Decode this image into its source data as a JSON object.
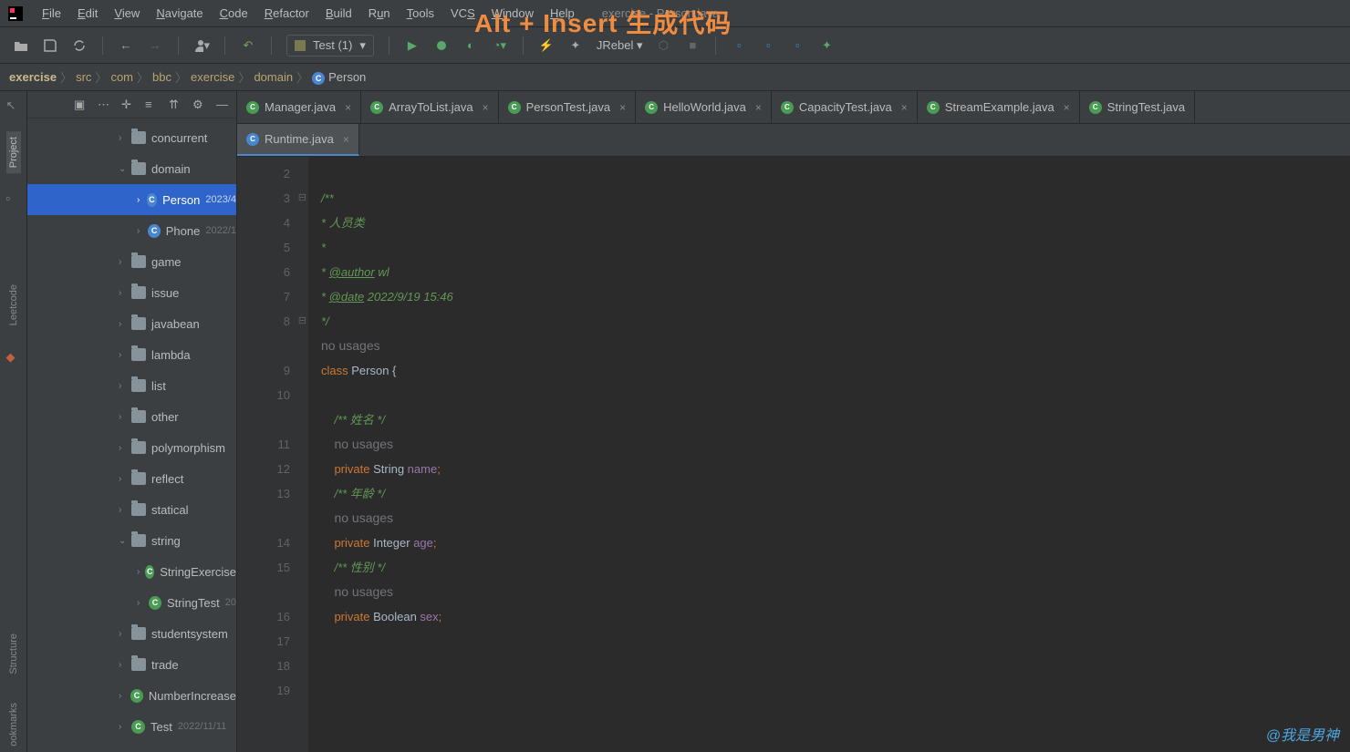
{
  "overlay": "Alt + Insert  生成代码",
  "menu": {
    "file": "File",
    "edit": "Edit",
    "view": "View",
    "navigate": "Navigate",
    "code": "Code",
    "refactor": "Refactor",
    "build": "Build",
    "run": "Run",
    "tools": "Tools",
    "vcs": "VCS",
    "window": "Window",
    "help": "Help",
    "title": "exercise - Person.java"
  },
  "toolbar": {
    "run_config": "Test (1)",
    "jrebel": "JRebel"
  },
  "breadcrumbs": [
    "exercise",
    "src",
    "com",
    "bbc",
    "exercise",
    "domain",
    "Person"
  ],
  "rail": {
    "project": "Project",
    "leetcode": "Leetcode",
    "structure": "Structure",
    "bookmarks": "ookmarks"
  },
  "tree": [
    {
      "ind": "ind3",
      "arrow": "›",
      "type": "folder",
      "label": "concurrent"
    },
    {
      "ind": "ind3",
      "arrow": "⌄",
      "type": "folder",
      "label": "domain"
    },
    {
      "ind": "ind2",
      "arrow": "›",
      "type": "class",
      "label": "Person",
      "date": "2023/4",
      "selected": true
    },
    {
      "ind": "ind2",
      "arrow": "›",
      "type": "class",
      "label": "Phone",
      "date": "2022/1"
    },
    {
      "ind": "ind3",
      "arrow": "›",
      "type": "folder",
      "label": "game"
    },
    {
      "ind": "ind3",
      "arrow": "›",
      "type": "folder",
      "label": "issue"
    },
    {
      "ind": "ind3",
      "arrow": "›",
      "type": "folder",
      "label": "javabean"
    },
    {
      "ind": "ind3",
      "arrow": "›",
      "type": "folder",
      "label": "lambda"
    },
    {
      "ind": "ind3",
      "arrow": "›",
      "type": "folder",
      "label": "list"
    },
    {
      "ind": "ind3",
      "arrow": "›",
      "type": "folder",
      "label": "other"
    },
    {
      "ind": "ind3",
      "arrow": "›",
      "type": "folder",
      "label": "polymorphism"
    },
    {
      "ind": "ind3",
      "arrow": "›",
      "type": "folder",
      "label": "reflect"
    },
    {
      "ind": "ind3",
      "arrow": "›",
      "type": "folder",
      "label": "statical"
    },
    {
      "ind": "ind3",
      "arrow": "⌄",
      "type": "folder",
      "label": "string"
    },
    {
      "ind": "ind2",
      "arrow": "›",
      "type": "class-g",
      "label": "StringExercise"
    },
    {
      "ind": "ind2",
      "arrow": "›",
      "type": "class-g",
      "label": "StringTest",
      "date": "20"
    },
    {
      "ind": "ind3",
      "arrow": "›",
      "type": "folder",
      "label": "studentsystem"
    },
    {
      "ind": "ind3",
      "arrow": "›",
      "type": "folder",
      "label": "trade"
    },
    {
      "ind": "ind3",
      "arrow": "›",
      "type": "class-g",
      "label": "NumberIncrease"
    },
    {
      "ind": "ind3",
      "arrow": "›",
      "type": "class-g",
      "label": "Test",
      "date": "2022/11/11"
    }
  ],
  "tabs_row1": [
    {
      "label": "Manager.java"
    },
    {
      "label": "ArrayToList.java"
    },
    {
      "label": "PersonTest.java"
    },
    {
      "label": "HelloWorld.java"
    },
    {
      "label": "CapacityTest.java"
    },
    {
      "label": "StreamExample.java"
    },
    {
      "label": "StringTest.java",
      "noclose": true
    }
  ],
  "tabs_row2": [
    {
      "label": "Runtime.java",
      "active": true
    }
  ],
  "line_numbers": [
    "2",
    "3",
    "4",
    "5",
    "6",
    "7",
    "8",
    "",
    "9",
    "10",
    "",
    "11",
    "12",
    "13",
    "",
    "14",
    "15",
    "",
    "16",
    "17",
    "18",
    "19"
  ],
  "code": {
    "l3": "/**",
    "l4": " * 人员类",
    "l5": " *",
    "l6p": " * ",
    "l6t": "@author",
    "l6s": " wl",
    "l7p": " * ",
    "l7t": "@date",
    "l7s": " 2022/9/19 15:46",
    "l8": " */",
    "hint": "no usages",
    "class_kw": "class",
    "class_name": " Person ",
    "brace": "{",
    "c_name": "/** 姓名 */",
    "private": "private",
    "t_string": " String ",
    "f_name": "name",
    "semi": ";",
    "c_age": "/** 年龄 */",
    "t_int": " Integer ",
    "f_age": "age",
    "c_sex": "/** 性别 */",
    "t_bool": " Boolean ",
    "f_sex": "sex"
  },
  "watermark": "@我是男神"
}
